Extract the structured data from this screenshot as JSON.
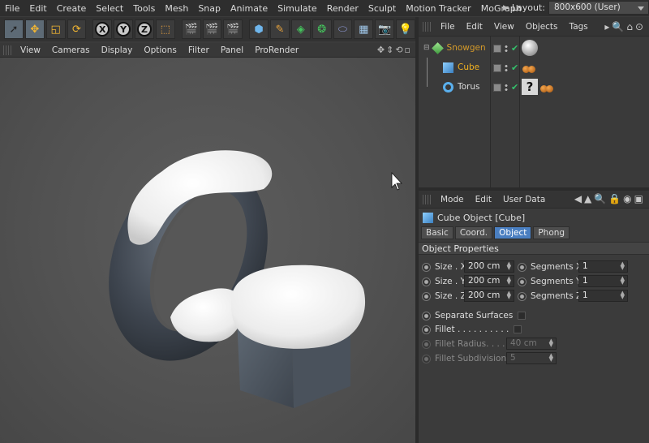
{
  "menubar": {
    "items": [
      "File",
      "Edit",
      "Create",
      "Select",
      "Tools",
      "Mesh",
      "Snap",
      "Animate",
      "Simulate",
      "Render",
      "Sculpt",
      "Motion Tracker",
      "MoGraph"
    ],
    "layout_label": "Layout:",
    "layout_value": "800x600 (User)"
  },
  "toolbar": {
    "axis_x": "X",
    "axis_y": "Y",
    "axis_z": "Z"
  },
  "viewport": {
    "menu": [
      "View",
      "Cameras",
      "Display",
      "Options",
      "Filter",
      "Panel",
      "ProRender"
    ]
  },
  "object_manager": {
    "menu": [
      "File",
      "Edit",
      "View",
      "Objects",
      "Tags"
    ],
    "objects": [
      {
        "name": "Snowgen",
        "color": "#d49a2a"
      },
      {
        "name": "Cube",
        "color": "#f0b020"
      },
      {
        "name": "Torus",
        "color": "#d8d8d8"
      }
    ]
  },
  "attribute_manager": {
    "menu": [
      "Mode",
      "Edit",
      "User Data"
    ],
    "title": "Cube Object [Cube]",
    "tabs": [
      "Basic",
      "Coord.",
      "Object",
      "Phong"
    ],
    "active_tab": "Object",
    "section": "Object Properties",
    "size_x_label": "Size . X",
    "size_x": "200 cm",
    "size_y_label": "Size . Y",
    "size_y": "200 cm",
    "size_z_label": "Size . Z",
    "size_z": "200 cm",
    "seg_x_label": "Segments X",
    "seg_x": "1",
    "seg_y_label": "Segments Y",
    "seg_y": "1",
    "seg_z_label": "Segments Z",
    "seg_z": "1",
    "separate_surfaces": "Separate Surfaces",
    "fillet": "Fillet . . . . . . . . . .",
    "fillet_radius_label": "Fillet Radius. . . . .",
    "fillet_radius": "40 cm",
    "fillet_subdiv_label": "Fillet Subdivision",
    "fillet_subdiv": "5"
  },
  "colors": {
    "accent": "#4a7fc1",
    "selected_object": "#f0b020",
    "check": "#34c06b"
  }
}
